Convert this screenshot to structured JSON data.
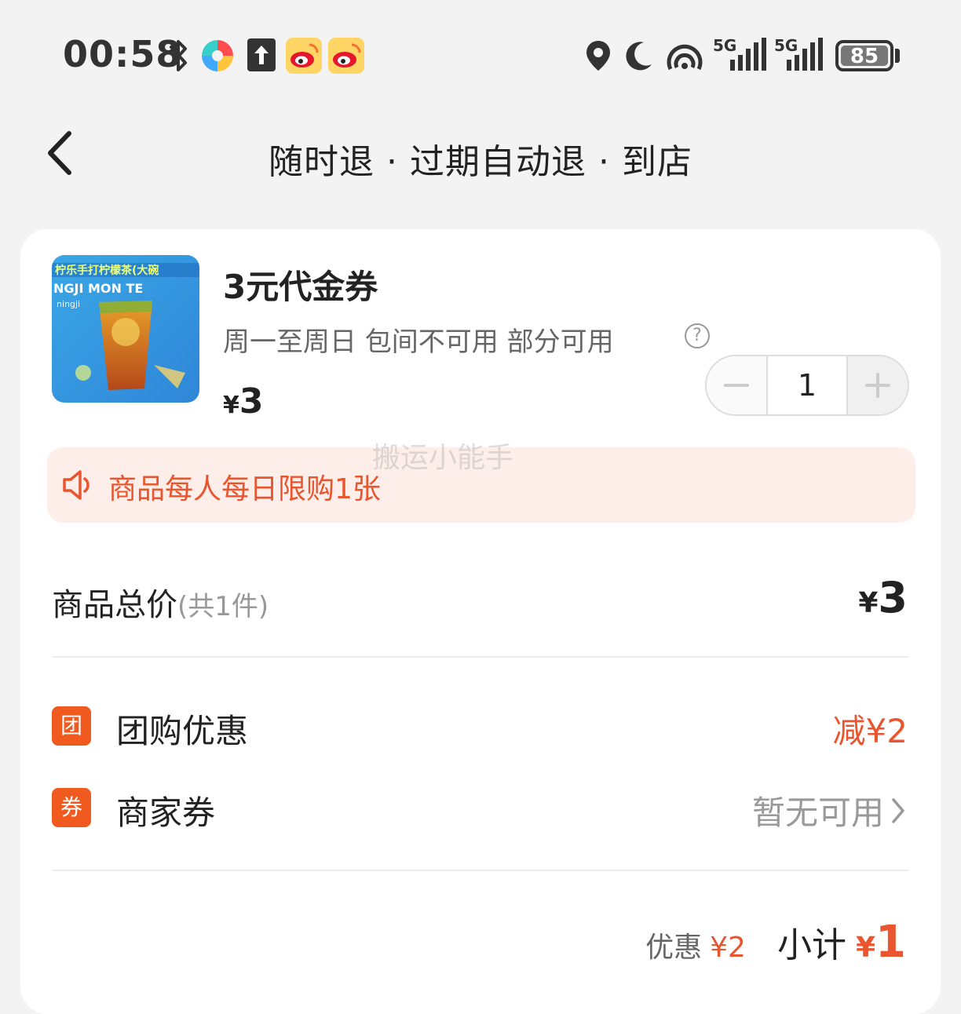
{
  "status_bar": {
    "time": "00:58",
    "battery": "85",
    "network1": "5G",
    "network2": "5G"
  },
  "header": {
    "title": "随时退 · 过期自动退 · 到店"
  },
  "product": {
    "title": "3元代金券",
    "desc": "周一至周日 包间不可用 部分可用",
    "help": "?",
    "price_symbol": "¥",
    "price": "3",
    "quantity": "1",
    "thumb_text1": "柠乐手打柠檬茶(大碗",
    "thumb_text2": "NGJI  MON  TE",
    "thumb_text3": "ningji"
  },
  "notice": {
    "text": "商品每人每日限购1张"
  },
  "watermark": "搬运小能手",
  "total": {
    "label": "商品总价",
    "count": "(共1件)",
    "symbol": "¥",
    "value": "3"
  },
  "discounts": {
    "group_badge": "团",
    "group_label": "团购优惠",
    "group_value": "减¥2",
    "shop_badge": "券",
    "shop_label": "商家券",
    "shop_value": "暂无可用"
  },
  "footer": {
    "discount_label": "优惠",
    "discount_value": "¥2",
    "subtotal_label": "小计",
    "subtotal_symbol": "¥",
    "subtotal_value": "1"
  },
  "colors": {
    "accent": "#e9552f",
    "badge": "#f05a1f",
    "notice_bg": "#fdeee9"
  }
}
